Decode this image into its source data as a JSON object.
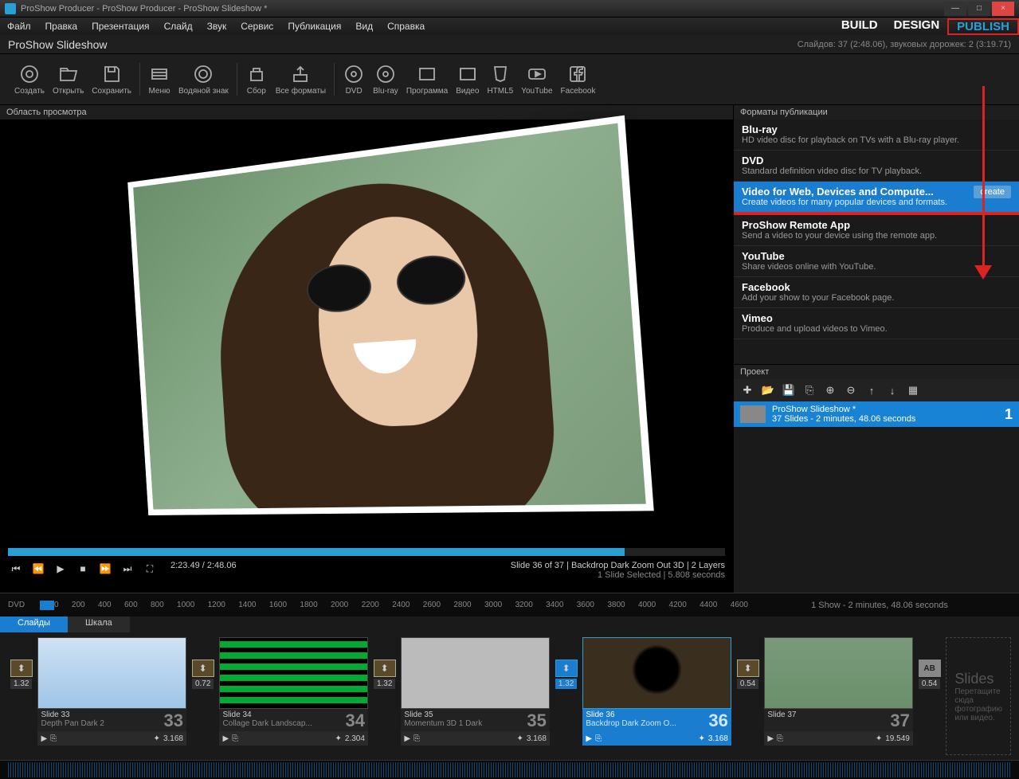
{
  "window": {
    "title": "ProShow Producer - ProShow Producer - ProShow Slideshow *"
  },
  "menu": [
    "Файл",
    "Правка",
    "Презентация",
    "Слайд",
    "Звук",
    "Сервис",
    "Публикация",
    "Вид",
    "Справка"
  ],
  "modes": {
    "build": "BUILD",
    "design": "DESIGN",
    "publish": "PUBLISH"
  },
  "info": {
    "title": "ProShow Slideshow",
    "stats": "Слайдов: 37 (2:48.06), звуковых дорожек: 2 (3:19.71)"
  },
  "toolbar": {
    "g1": [
      "Создать",
      "Открыть",
      "Сохранить"
    ],
    "g2": [
      "Меню",
      "Водяной знак"
    ],
    "g3": [
      "Сбор",
      "Все форматы"
    ],
    "g4": [
      "DVD",
      "Blu-ray",
      "Программа",
      "Видео",
      "HTML5",
      "YouTube",
      "Facebook"
    ]
  },
  "preview": {
    "label": "Область просмотра",
    "time": "2:23.49 / 2:48.06",
    "slide_info": "Slide 36 of 37  |  Backdrop Dark Zoom Out 3D  |  2 Layers",
    "selected": "1 Slide Selected  |  5.808 seconds"
  },
  "publish": {
    "header": "Форматы публикации",
    "items": [
      {
        "title": "Blu-ray",
        "desc": "HD video disc for playback on TVs with a Blu-ray player."
      },
      {
        "title": "DVD",
        "desc": "Standard definition video disc for TV playback."
      },
      {
        "title": "Video for Web, Devices and Compute...",
        "desc": "Create videos for many popular devices and formats.",
        "selected": true,
        "create": "create"
      },
      {
        "title": "ProShow Remote App",
        "desc": "Send a video to your device using the remote app."
      },
      {
        "title": "YouTube",
        "desc": "Share videos online with YouTube."
      },
      {
        "title": "Facebook",
        "desc": "Add your show to your Facebook page."
      },
      {
        "title": "Vimeo",
        "desc": "Produce and upload videos to Vimeo."
      }
    ]
  },
  "project": {
    "header": "Проект",
    "item_title": "ProShow Slideshow *",
    "item_sub": "37 Slides - 2 minutes, 48.06 seconds",
    "item_num": "1"
  },
  "ruler": {
    "label": "DVD",
    "ticks": [
      "0",
      "200",
      "400",
      "600",
      "800",
      "1000",
      "1200",
      "1400",
      "1600",
      "1800",
      "2000",
      "2200",
      "2400",
      "2600",
      "2800",
      "3000",
      "3200",
      "3400",
      "3600",
      "3800",
      "4000",
      "4200",
      "4400",
      "4600"
    ],
    "right": "1 Show - 2 minutes, 48.06 seconds"
  },
  "tl_tabs": {
    "a": "Слайды",
    "b": "Шкала"
  },
  "timeline": {
    "slides": [
      {
        "trans_time": "1.32",
        "name": "Slide 33",
        "effect": "Depth Pan Dark 2",
        "num": "33",
        "dur": "3.168"
      },
      {
        "trans_time": "0.72",
        "name": "Slide 34",
        "effect": "Collage Dark Landscap...",
        "num": "34",
        "dur": "2.304"
      },
      {
        "trans_time": "1.32",
        "name": "Slide 35",
        "effect": "Momentum 3D 1 Dark",
        "num": "35",
        "dur": "3.168"
      },
      {
        "trans_time": "1.32",
        "name": "Slide 36",
        "effect": "Backdrop Dark Zoom O...",
        "num": "36",
        "dur": "3.168",
        "selected": true
      },
      {
        "trans_time": "0.54",
        "name": "Slide 37",
        "effect": "",
        "num": "37",
        "dur": "19.549"
      }
    ],
    "drop_title": "Slides",
    "drop_sub": "Перетащите сюда фотографию или видео."
  }
}
